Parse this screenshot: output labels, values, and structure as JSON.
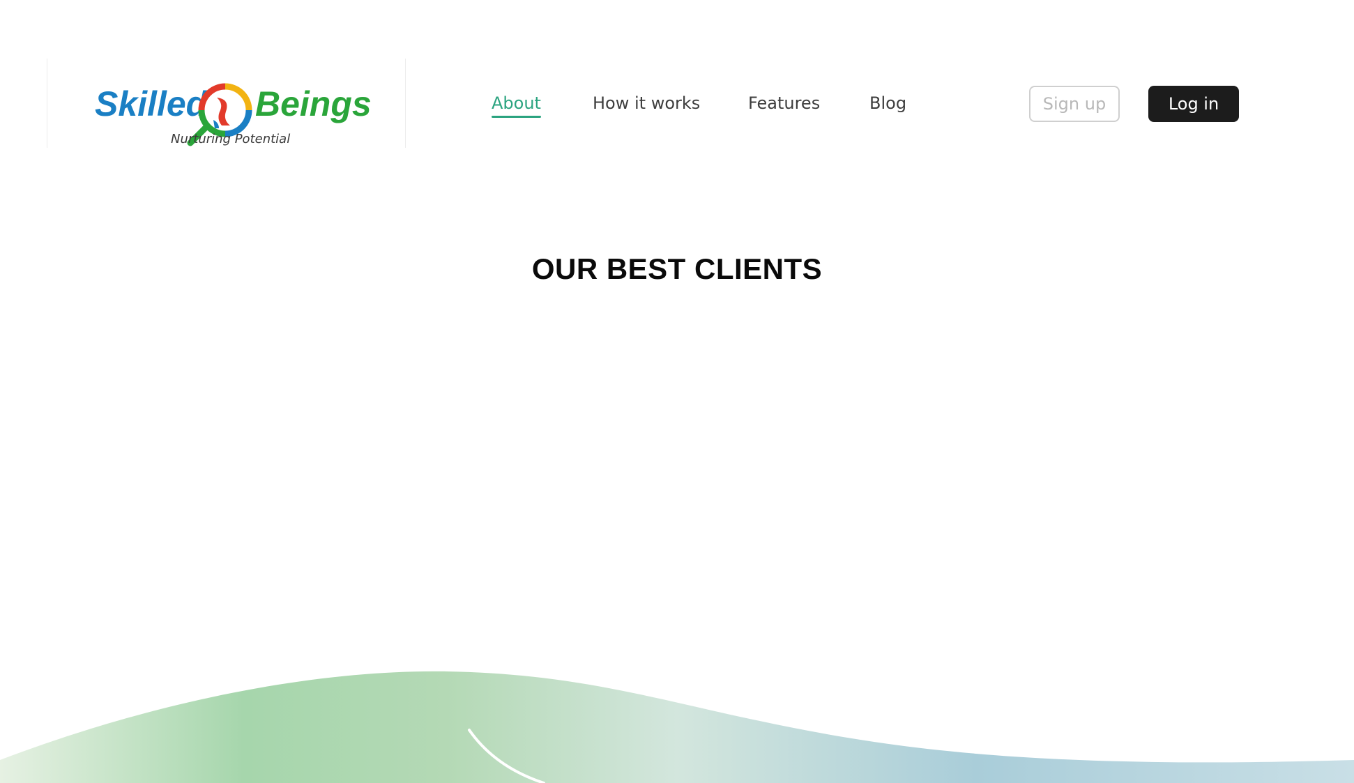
{
  "brand": {
    "name_part1": "Skilled",
    "name_part2": "Beings",
    "tagline": "Nurturing Potential",
    "colors": {
      "blue": "#1a7fc4",
      "green": "#2aa53a",
      "red": "#e23a2a",
      "yellow": "#f2b312"
    }
  },
  "nav": {
    "items": [
      {
        "label": "About",
        "active": true
      },
      {
        "label": "How it works",
        "active": false
      },
      {
        "label": "Features",
        "active": false
      },
      {
        "label": "Blog",
        "active": false
      }
    ]
  },
  "auth": {
    "signup_label": "Sign up",
    "login_label": "Log in"
  },
  "section": {
    "title": "OUR BEST CLIENTS"
  },
  "colors": {
    "accent": "#2aa37f",
    "login_bg": "#1c1c1c",
    "wave_green": "#a6d6ac",
    "wave_blue": "#a9cdd9"
  }
}
